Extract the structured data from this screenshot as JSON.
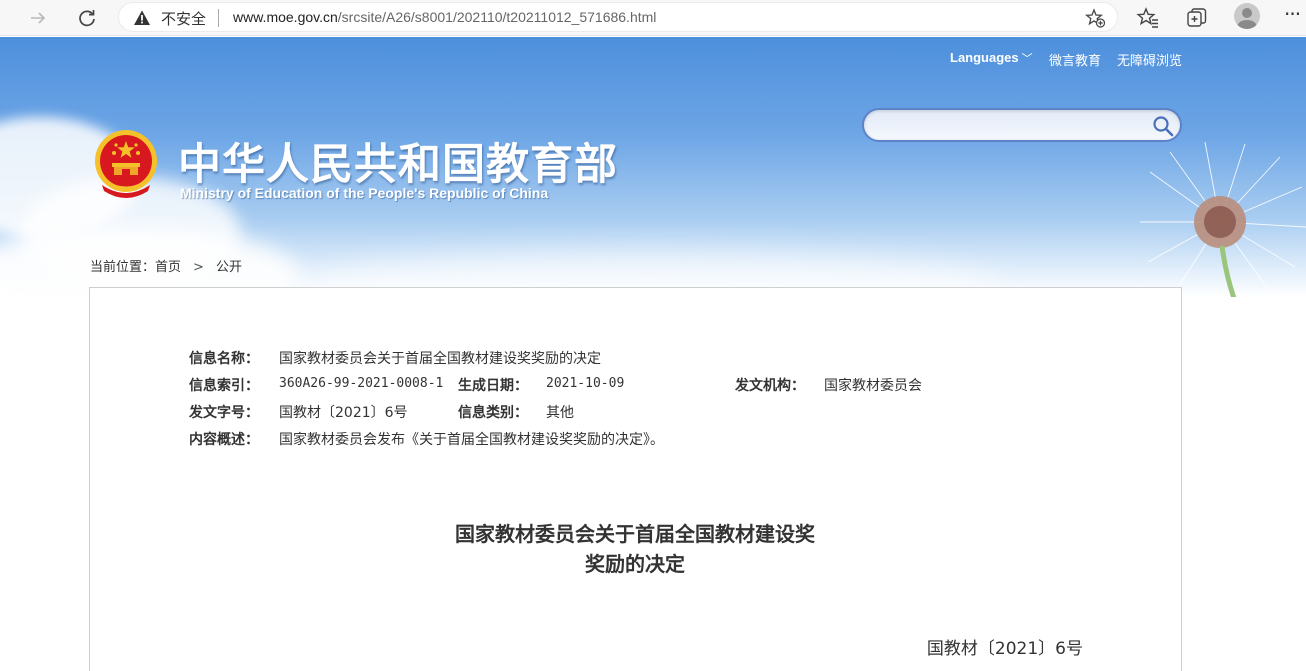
{
  "browser": {
    "insecure_label": "不安全",
    "url_host": "www.moe.gov.cn",
    "url_path": "/srcsite/A26/s8001/202110/t20211012_571686.html"
  },
  "header": {
    "site_name_cn": "中华人民共和国教育部",
    "site_name_en": "Ministry of Education of the People's Republic of China",
    "languages_label": "Languages",
    "weiyan_label": "微言教育",
    "accessibility_label": "无障碍浏览",
    "search_placeholder": ""
  },
  "breadcrumb": {
    "prefix": "当前位置：",
    "home": "首页",
    "separator": ">",
    "current": "公开"
  },
  "meta": {
    "info_name_label": "信息名称：",
    "info_name_value": "国家教材委员会关于首届全国教材建设奖奖励的决定",
    "index_label": "信息索引：",
    "index_value": "360A26-99-2021-0008-1",
    "date_label": "生成日期：",
    "date_value": "2021-10-09",
    "issuer_label": "发文机构：",
    "issuer_value": "国家教材委员会",
    "doc_no_label": "发文字号：",
    "doc_no_value": "国教材〔2021〕6号",
    "category_label": "信息类别：",
    "category_value": "其他",
    "summary_label": "内容概述：",
    "summary_value": "国家教材委员会发布《关于首届全国教材建设奖奖励的决定》。"
  },
  "document": {
    "title_line1": "国家教材委员会关于首届全国教材建设奖",
    "title_line2": "奖励的决定",
    "doc_number": "国教材〔2021〕6号"
  },
  "colors": {
    "banner_top": "#4d8fdc",
    "search_border": "#5d82c9",
    "emblem_red": "#d7191f",
    "emblem_gold": "#f5c12b"
  },
  "icons": [
    "forward-icon",
    "refresh-icon",
    "warning-icon",
    "add-favorite-icon",
    "favorites-icon",
    "collections-icon",
    "profile-icon",
    "more-icon",
    "search-icon",
    "national-emblem"
  ]
}
